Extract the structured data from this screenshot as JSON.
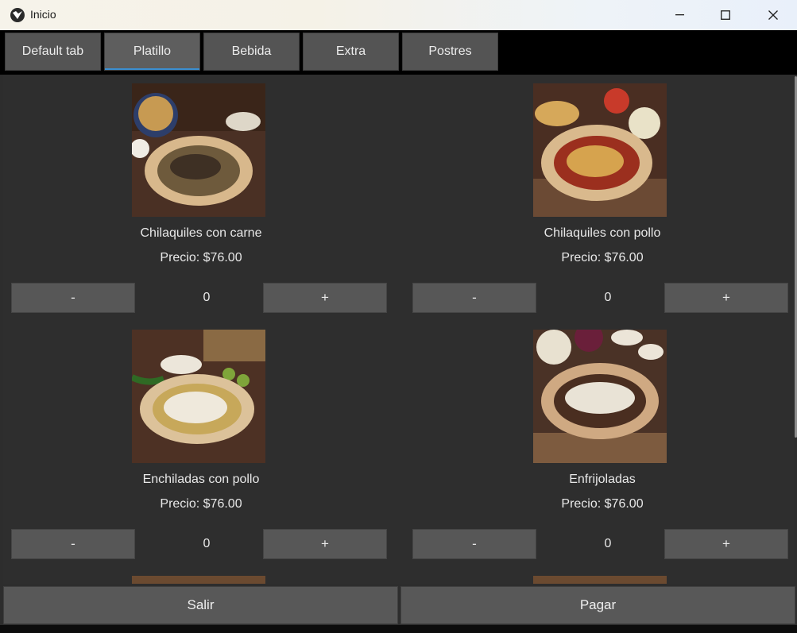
{
  "window": {
    "title": "Inicio"
  },
  "controls": {
    "minimize": "—",
    "maximize": "☐",
    "close": "✕"
  },
  "tabs": [
    {
      "label": "Default tab",
      "active": false
    },
    {
      "label": "Platillo",
      "active": true
    },
    {
      "label": "Bebida",
      "active": false
    },
    {
      "label": "Extra",
      "active": false
    },
    {
      "label": "Postres",
      "active": false
    }
  ],
  "items": [
    {
      "name": "Chilaquiles con carne",
      "price": "Precio: $76.00",
      "minus": "-",
      "qty": "0",
      "plus": "+"
    },
    {
      "name": "Chilaquiles con pollo",
      "price": "Precio: $76.00",
      "minus": "-",
      "qty": "0",
      "plus": "+"
    },
    {
      "name": "Enchiladas con pollo",
      "price": "Precio: $76.00",
      "minus": "-",
      "qty": "0",
      "plus": "+"
    },
    {
      "name": "Enfrijoladas",
      "price": "Precio: $76.00",
      "minus": "-",
      "qty": "0",
      "plus": "+"
    }
  ],
  "footer": {
    "exit_label": "Salir",
    "pay_label": "Pagar"
  },
  "colors": {
    "accent": "#3b8fd1",
    "button": "#575757",
    "panel": "#2e2e2e"
  }
}
